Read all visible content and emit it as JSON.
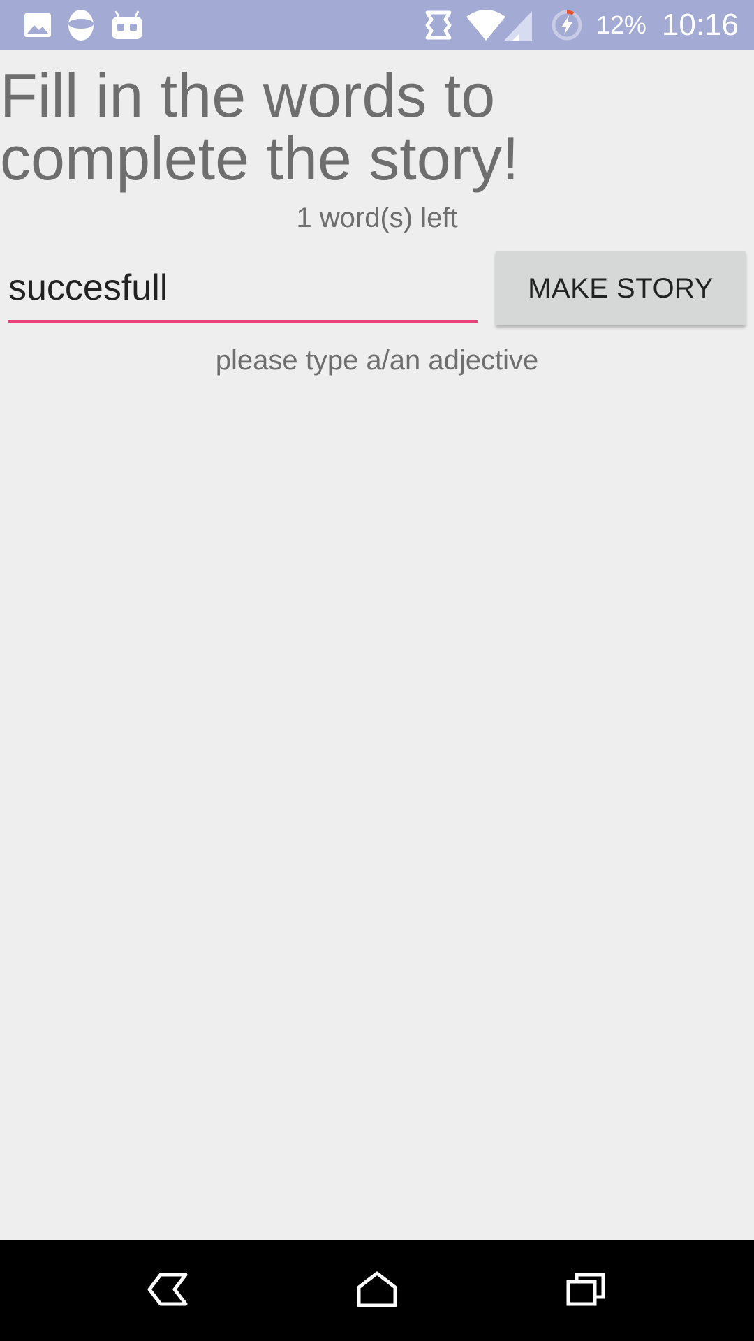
{
  "status_bar": {
    "icons_left": [
      "image-icon",
      "cyanogen-icon",
      "android-robot-icon"
    ],
    "icons_right": [
      "nfc-icon",
      "wifi-icon",
      "signal-icon",
      "battery-charging-icon"
    ],
    "battery_percent": "12%",
    "time": "10:16",
    "background": "#a3aad4"
  },
  "main": {
    "title": "Fill in the words to complete the story!",
    "words_left": "1 word(s) left",
    "input_value": "succesfull",
    "button_label": "MAKE STORY",
    "prompt": "please type a/an adjective"
  },
  "colors": {
    "accent": "#ec407a",
    "background": "#eeeeee",
    "text_gray": "#6e6e6e",
    "button_bg": "#d6d7d7"
  },
  "nav_bar": {
    "buttons": [
      "back-icon",
      "home-icon",
      "recents-icon"
    ]
  }
}
